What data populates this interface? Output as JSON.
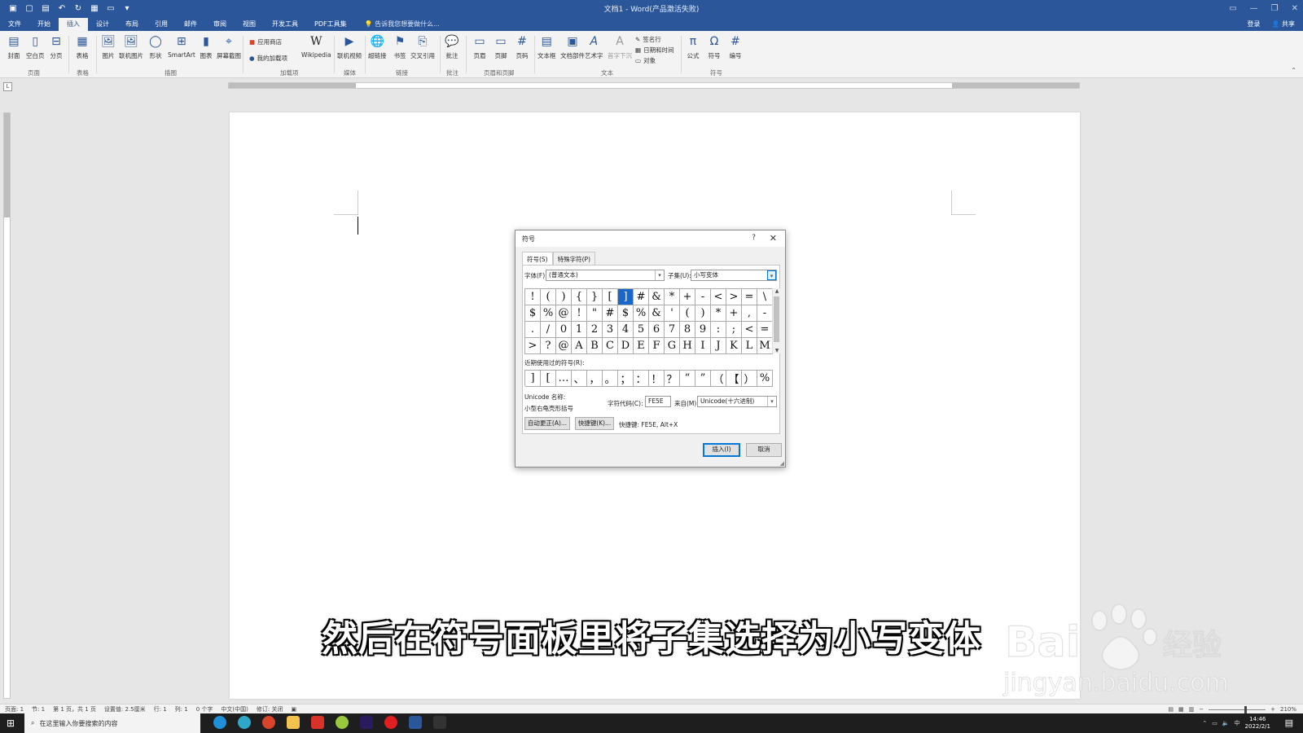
{
  "window": {
    "title": "文档1 - Word(产品激活失败)"
  },
  "menu_tabs": [
    {
      "label": "文件"
    },
    {
      "label": "开始"
    },
    {
      "label": "插入",
      "active": true
    },
    {
      "label": "设计"
    },
    {
      "label": "布局"
    },
    {
      "label": "引用"
    },
    {
      "label": "邮件"
    },
    {
      "label": "审阅"
    },
    {
      "label": "视图"
    },
    {
      "label": "开发工具"
    },
    {
      "label": "PDF工具集"
    }
  ],
  "tell_me": "告诉我您想要做什么...",
  "account": {
    "signin": "登录",
    "share": "共享"
  },
  "ribbon": {
    "pages": {
      "cover": "封面",
      "blank": "空白页",
      "break": "分页",
      "group": "页面"
    },
    "tables": {
      "table": "表格",
      "group": "表格"
    },
    "illustrations": {
      "picture": "图片",
      "online_picture": "联机图片",
      "shapes": "形状",
      "smartart": "SmartArt",
      "chart": "图表",
      "screenshot": "屏幕截图",
      "group": "插图"
    },
    "addins": {
      "store": "应用商店",
      "my_addins": "我的加载项",
      "wikipedia": "Wikipedia",
      "group": "加载项"
    },
    "media": {
      "video": "联机视频",
      "group": "媒体"
    },
    "links": {
      "hyperlink": "超链接",
      "bookmark": "书签",
      "crossref": "交叉引用",
      "group": "链接"
    },
    "comments": {
      "comment": "批注",
      "group": "批注"
    },
    "header_footer": {
      "header": "页眉",
      "footer": "页脚",
      "page_number": "页码",
      "group": "页眉和页脚"
    },
    "text": {
      "textbox": "文本框",
      "quickparts": "文档部件",
      "wordart": "艺术字",
      "dropcap": "首字下沉",
      "signature": "签名行",
      "datetime": "日期和时间",
      "object": "对象",
      "group": "文本"
    },
    "symbols": {
      "equation": "公式",
      "symbol": "符号",
      "number": "编号",
      "group": "符号"
    }
  },
  "dialog": {
    "title": "符号",
    "help": "?",
    "tabs": [
      {
        "label": "符号(S)",
        "active": true
      },
      {
        "label": "特殊字符(P)"
      }
    ],
    "font_label": "字体(F):",
    "font_value": "(普通文本)",
    "subset_label": "子集(U):",
    "subset_value": "小写变体",
    "symbols": [
      "!",
      "(",
      ")",
      "{",
      "}",
      "[",
      "]",
      "#",
      "&",
      "*",
      "+",
      "-",
      "<",
      ">",
      "=",
      "\\",
      "$",
      "%",
      "@",
      "!",
      "\"",
      "#",
      "$",
      "%",
      "&",
      "'",
      "(",
      ")",
      "*",
      "+",
      ",",
      "-",
      ".",
      "/",
      "0",
      "1",
      "2",
      "3",
      "4",
      "5",
      "6",
      "7",
      "8",
      "9",
      ":",
      ";",
      "<",
      "=",
      ">",
      "?",
      "@",
      "A",
      "B",
      "C",
      "D",
      "E",
      "F",
      "G",
      "H",
      "I",
      "J",
      "K",
      "L",
      "M"
    ],
    "selected_index": 6,
    "recent_label": "近期使用过的符号(R):",
    "recent": [
      "]",
      "[",
      "…",
      "、",
      "，",
      "。",
      "；",
      "：",
      "！",
      "？",
      "“",
      "”",
      "（",
      "【",
      "）",
      "%"
    ],
    "unicode_name_label": "Unicode 名称:",
    "unicode_name": "小型右龟壳形括号",
    "charcode_label": "字符代码(C):",
    "charcode_value": "FE5E",
    "from_label": "来自(M):",
    "from_value": "Unicode(十六进制)",
    "autocorrect_button": "自动更正(A)...",
    "shortcut_button": "快捷键(K)...",
    "shortcut_text": "快捷键: FE5E, Alt+X",
    "insert_button": "插入(I)",
    "cancel_button": "取消"
  },
  "subtitle": "然后在符号面板里将子集选择为小写变体",
  "watermark": {
    "brand": "Bai",
    "brand_cn": "经验",
    "url": "jingyan.baidu.com"
  },
  "statusbar": {
    "items": [
      "页面: 1",
      "节: 1",
      "第 1 页，共 1 页",
      "设置值: 2.5厘米",
      "行: 1",
      "列: 1",
      "0 个字",
      "中文(中国)",
      "修订: 关闭"
    ],
    "zoom": "210%"
  },
  "taskbar": {
    "search_placeholder": "在这里输入你要搜索的内容",
    "time": "14:46",
    "date": "2022/2/1"
  }
}
